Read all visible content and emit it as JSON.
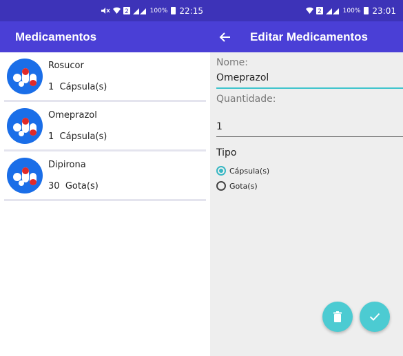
{
  "left": {
    "status": {
      "percent": "100%",
      "time": "22:15"
    },
    "title": "Medicamentos",
    "items": [
      {
        "name": "Rosucor",
        "quantity": "1",
        "unit": "Cápsula(s)"
      },
      {
        "name": "Omeprazol",
        "quantity": "1",
        "unit": "Cápsula(s)"
      },
      {
        "name": "Dipirona",
        "quantity": "30",
        "unit": "Gota(s)"
      }
    ]
  },
  "right": {
    "status": {
      "percent": "100%",
      "time": "23:01"
    },
    "title": "Editar Medicamentos",
    "form": {
      "name_label": "Nome:",
      "name_value": "Omeprazol",
      "qty_label": "Quantidade:",
      "qty_value": "1",
      "type_label": "Tipo",
      "options": [
        {
          "label": "Cápsula(s)",
          "checked": true
        },
        {
          "label": "Gota(s)",
          "checked": false
        }
      ]
    }
  },
  "colors": {
    "statusbar": "#3d33b8",
    "appbar": "#4a3fd6",
    "accent": "#4ccbd2",
    "avatar": "#1a6ee8"
  }
}
